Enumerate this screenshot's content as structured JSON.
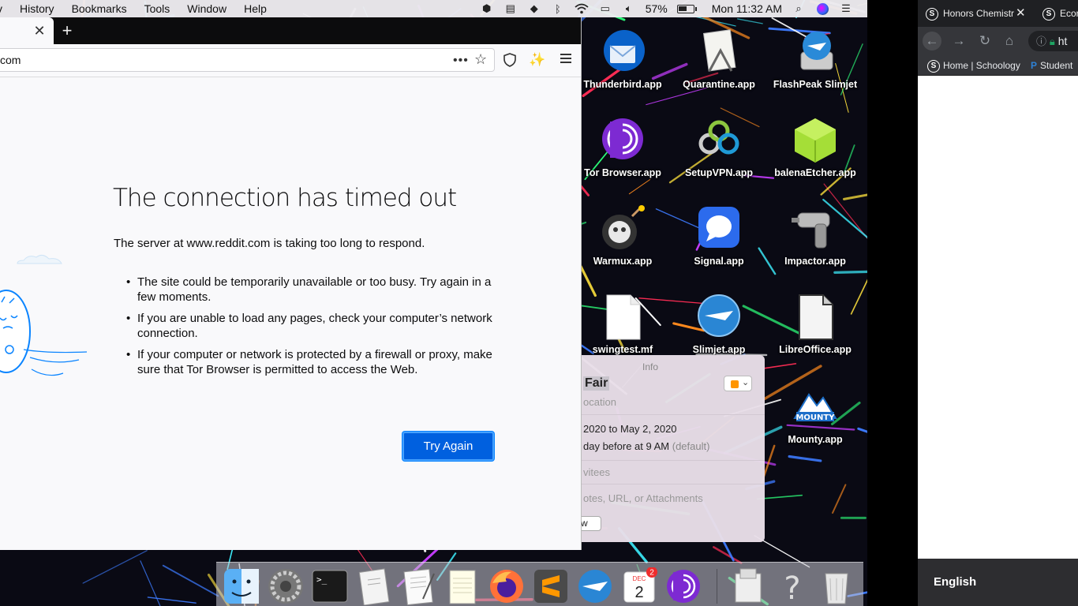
{
  "menubar": {
    "menus": [
      "v",
      "History",
      "Bookmarks",
      "Tools",
      "Window",
      "Help"
    ],
    "battery_percent": "57%",
    "battery_level": 0.57,
    "clock": "Mon 11:32 AM"
  },
  "browser": {
    "url": "com",
    "page_actions_icon": "•••",
    "error": {
      "title": "The connection has timed out",
      "description": "The server at www.reddit.com is taking too long to respond.",
      "bullets": [
        "The site could be temporarily unavailable or too busy. Try again in a few moments.",
        "If you are unable to load any pages, check your computer’s network connection.",
        "If your computer or network is protected by a firewall or proxy, make sure that Tor Browser is permitted to access the Web."
      ],
      "button_label": "Try Again"
    }
  },
  "desktop_icons": [
    {
      "label": "Thunderbird.app",
      "icon": "thunderbird-icon"
    },
    {
      "label": "Quarantine.app",
      "icon": "quarantine-icon"
    },
    {
      "label": "FlashPeak Slimjet",
      "icon": "flashpeak-slimjet-icon"
    },
    {
      "label": "Tor Browser.app",
      "icon": "tor-browser-icon"
    },
    {
      "label": "SetupVPN.app",
      "icon": "setupvpn-icon"
    },
    {
      "label": "balenaEtcher.app",
      "icon": "balenaetcher-icon"
    },
    {
      "label": "Warmux.app",
      "icon": "warmux-icon"
    },
    {
      "label": "Signal.app",
      "icon": "signal-icon"
    },
    {
      "label": "Impactor.app",
      "icon": "impactor-icon"
    },
    {
      "label": "swingtest.mf",
      "icon": "document-icon"
    },
    {
      "label": "Slimjet.app",
      "icon": "slimjet-icon"
    },
    {
      "label": "LibreOffice.app",
      "icon": "libreoffice-icon"
    },
    {
      "label": "Mounty.app",
      "icon": "mounty-icon"
    }
  ],
  "calendar_popover": {
    "header": "Info",
    "title": "Fair",
    "location_placeholder": "ocation",
    "dates": "2020 to May 2, 2020",
    "alert": "day before at 9 AM",
    "alert_default": "(default)",
    "invitees_placeholder": "vitees",
    "notes_placeholder": "otes, URL, or Attachments",
    "button_label": "w",
    "color": "#ff9500"
  },
  "dock": {
    "items": [
      "finder-icon",
      "system-preferences-icon",
      "terminal-icon",
      "script-editor-icon",
      "textedit-icon",
      "notes-icon",
      "firefox-icon",
      "sublime-text-icon",
      "slimjet-icon",
      "calendar-icon",
      "tor-browser-icon",
      "preview-icon",
      "help-icon",
      "trash-icon"
    ],
    "calendar_month": "DEC",
    "calendar_day": "2",
    "calendar_badge": "2"
  },
  "chrome": {
    "tabs": [
      {
        "label": "Honors Chemistr",
        "close": "✕"
      },
      {
        "label": "Econ"
      }
    ],
    "omnibox_text": "ht",
    "bookmarks": [
      "Home | Schoology",
      "Student"
    ],
    "language": "English"
  }
}
